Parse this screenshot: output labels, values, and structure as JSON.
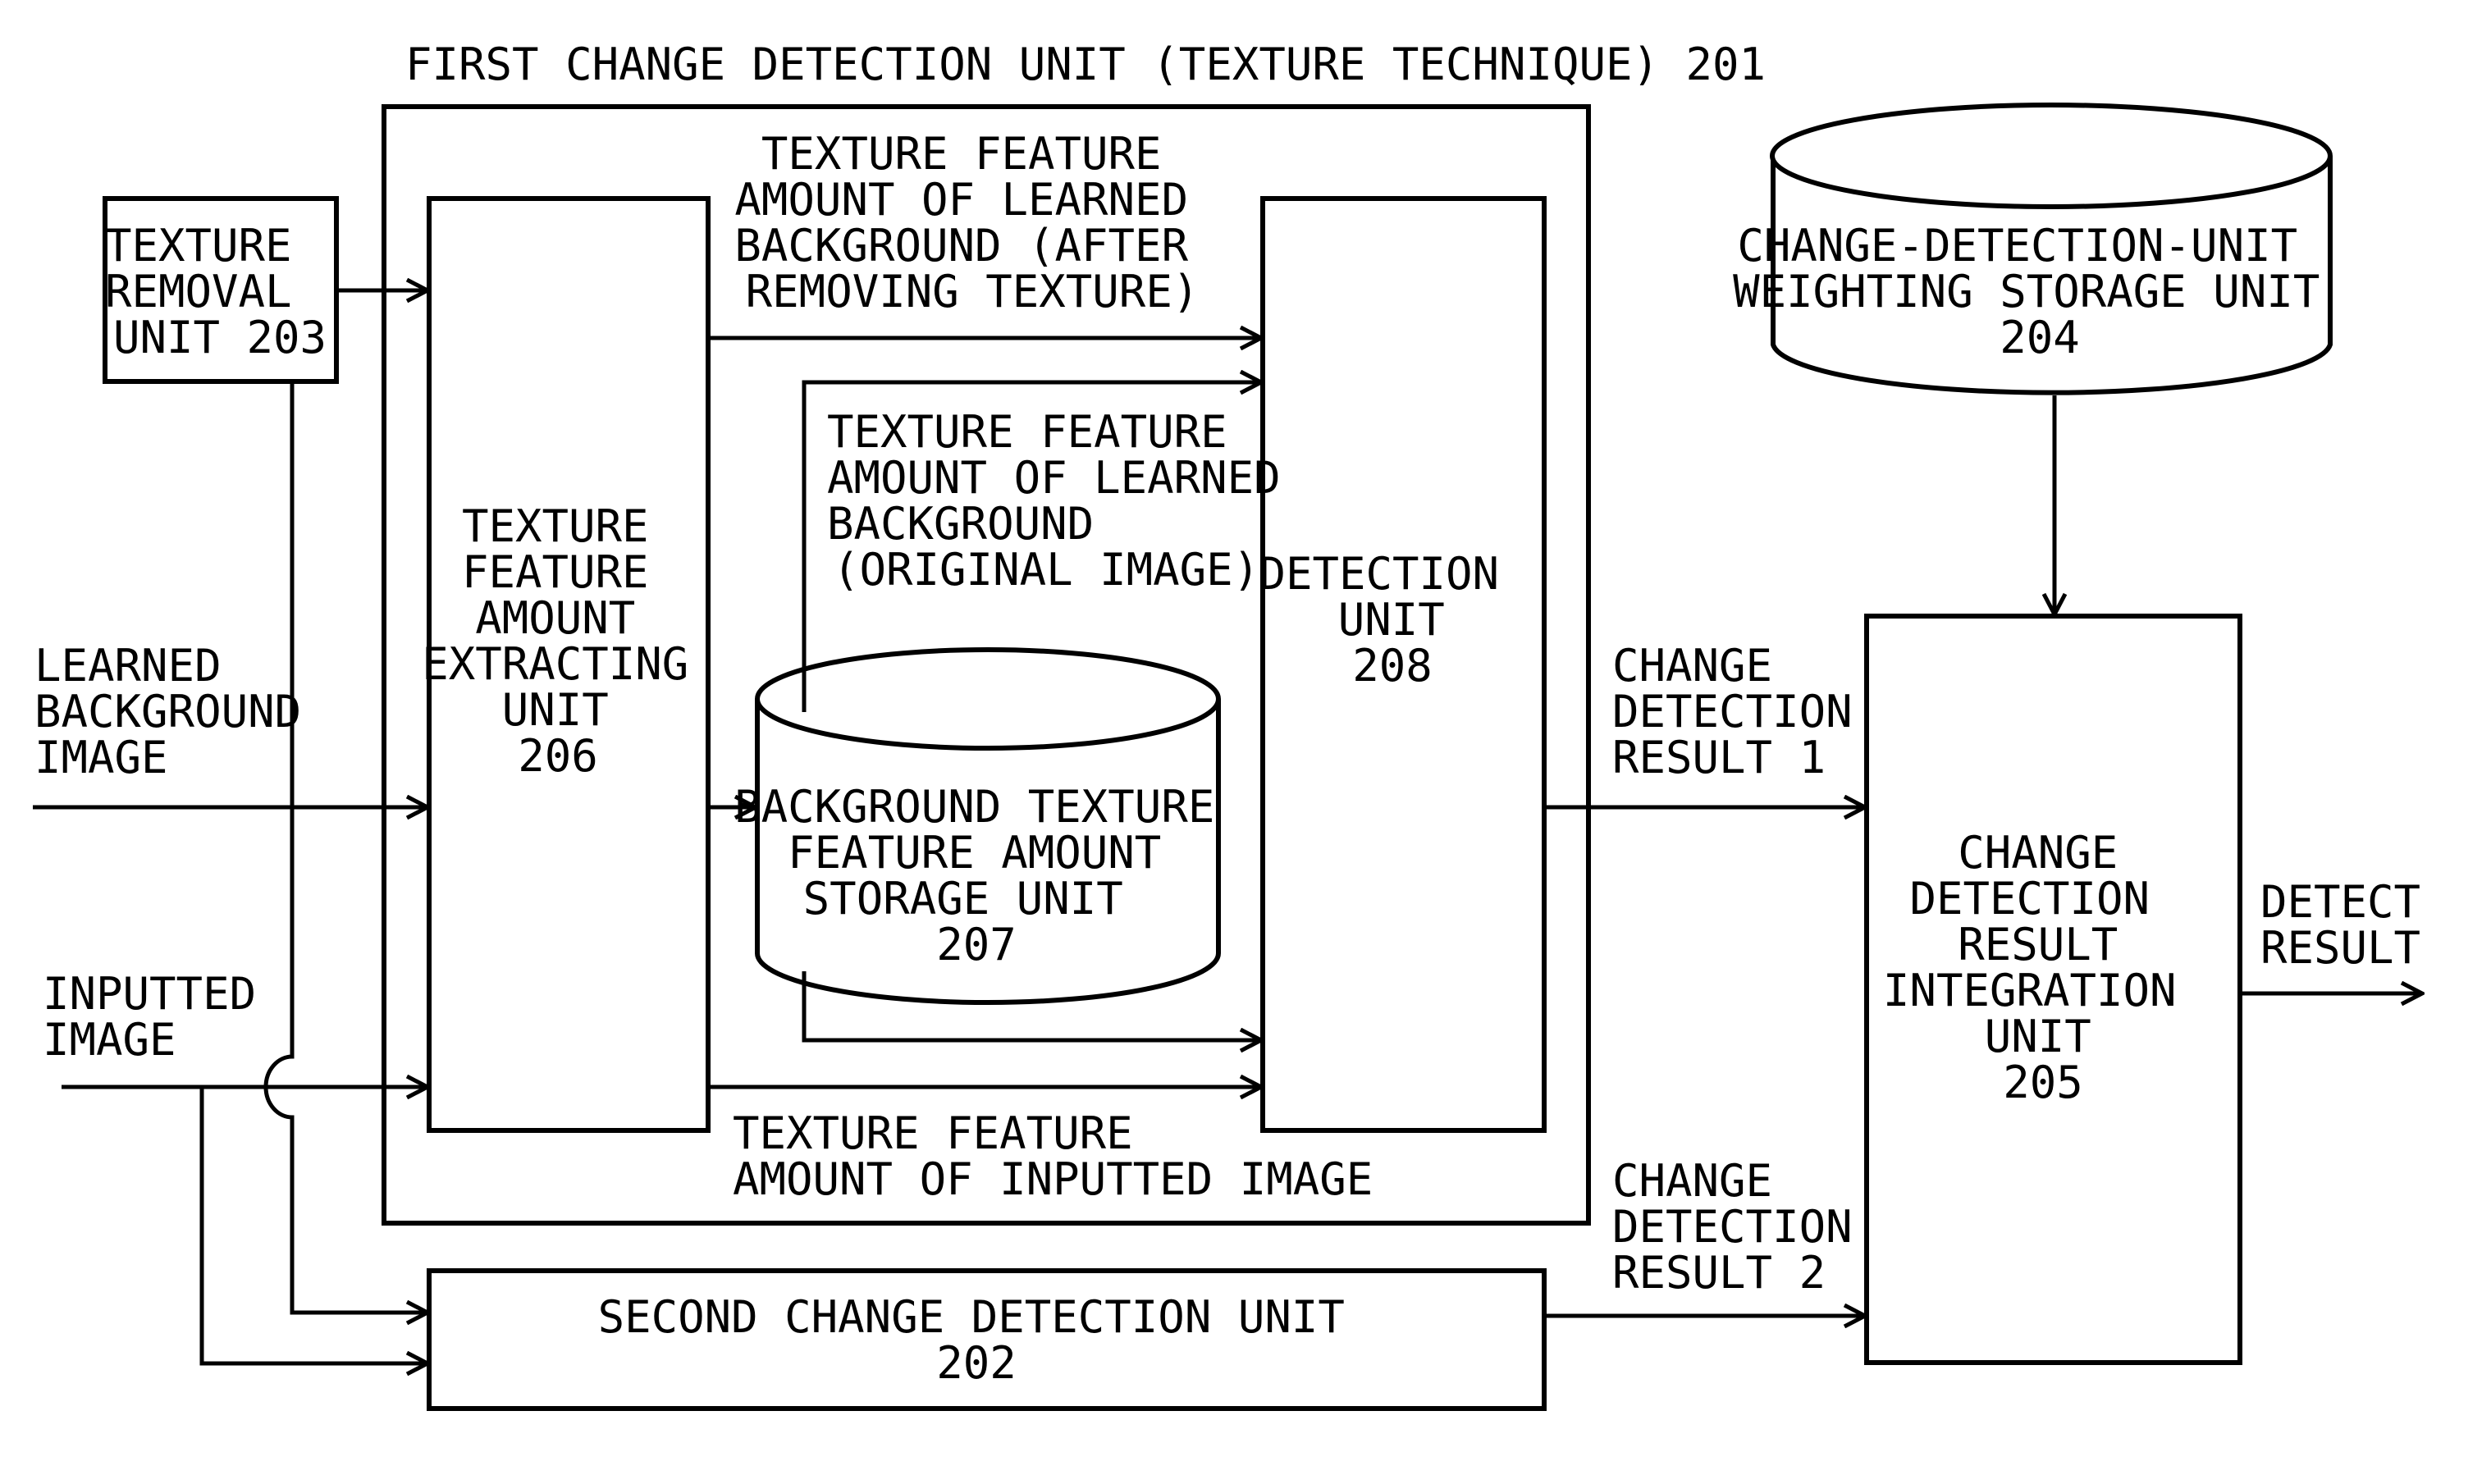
{
  "diagram": {
    "title": "FIRST CHANGE DETECTION UNIT (TEXTURE TECHNIQUE) 201",
    "blocks": {
      "texture_removal": [
        "TEXTURE",
        "REMOVAL",
        "UNIT 203"
      ],
      "extracting": [
        "TEXTURE",
        "FEATURE",
        "AMOUNT",
        "EXTRACTING",
        "UNIT",
        "206"
      ],
      "bg_storage": [
        "BACKGROUND TEXTURE",
        "FEATURE AMOUNT",
        "STORAGE UNIT",
        "207"
      ],
      "detection": [
        "DETECTION",
        "UNIT",
        "208"
      ],
      "weighting_storage": [
        "CHANGE-DETECTION-UNIT",
        "WEIGHTING STORAGE UNIT",
        "204"
      ],
      "integration": [
        "CHANGE",
        "DETECTION",
        "RESULT",
        "INTEGRATION",
        "UNIT",
        "205"
      ],
      "second_unit": [
        "SECOND CHANGE DETECTION UNIT",
        "202"
      ]
    },
    "labels": {
      "learned_bg_after": [
        "TEXTURE FEATURE",
        "AMOUNT OF LEARNED",
        "BACKGROUND (AFTER",
        "REMOVING TEXTURE)"
      ],
      "learned_bg_original": [
        "TEXTURE FEATURE",
        "AMOUNT OF LEARNED",
        "BACKGROUND",
        "(ORIGINAL IMAGE)"
      ],
      "inputted_feature": [
        "TEXTURE FEATURE",
        "AMOUNT OF INPUTTED IMAGE"
      ],
      "learned_bg_image": [
        "LEARNED",
        "BACKGROUND",
        "IMAGE"
      ],
      "inputted_image": [
        "INPUTTED",
        "IMAGE"
      ],
      "result1": [
        "CHANGE",
        "DETECTION",
        "RESULT 1"
      ],
      "result2": [
        "CHANGE",
        "DETECTION",
        "RESULT 2"
      ],
      "detect_result": [
        "DETECT",
        "RESULT"
      ]
    }
  }
}
